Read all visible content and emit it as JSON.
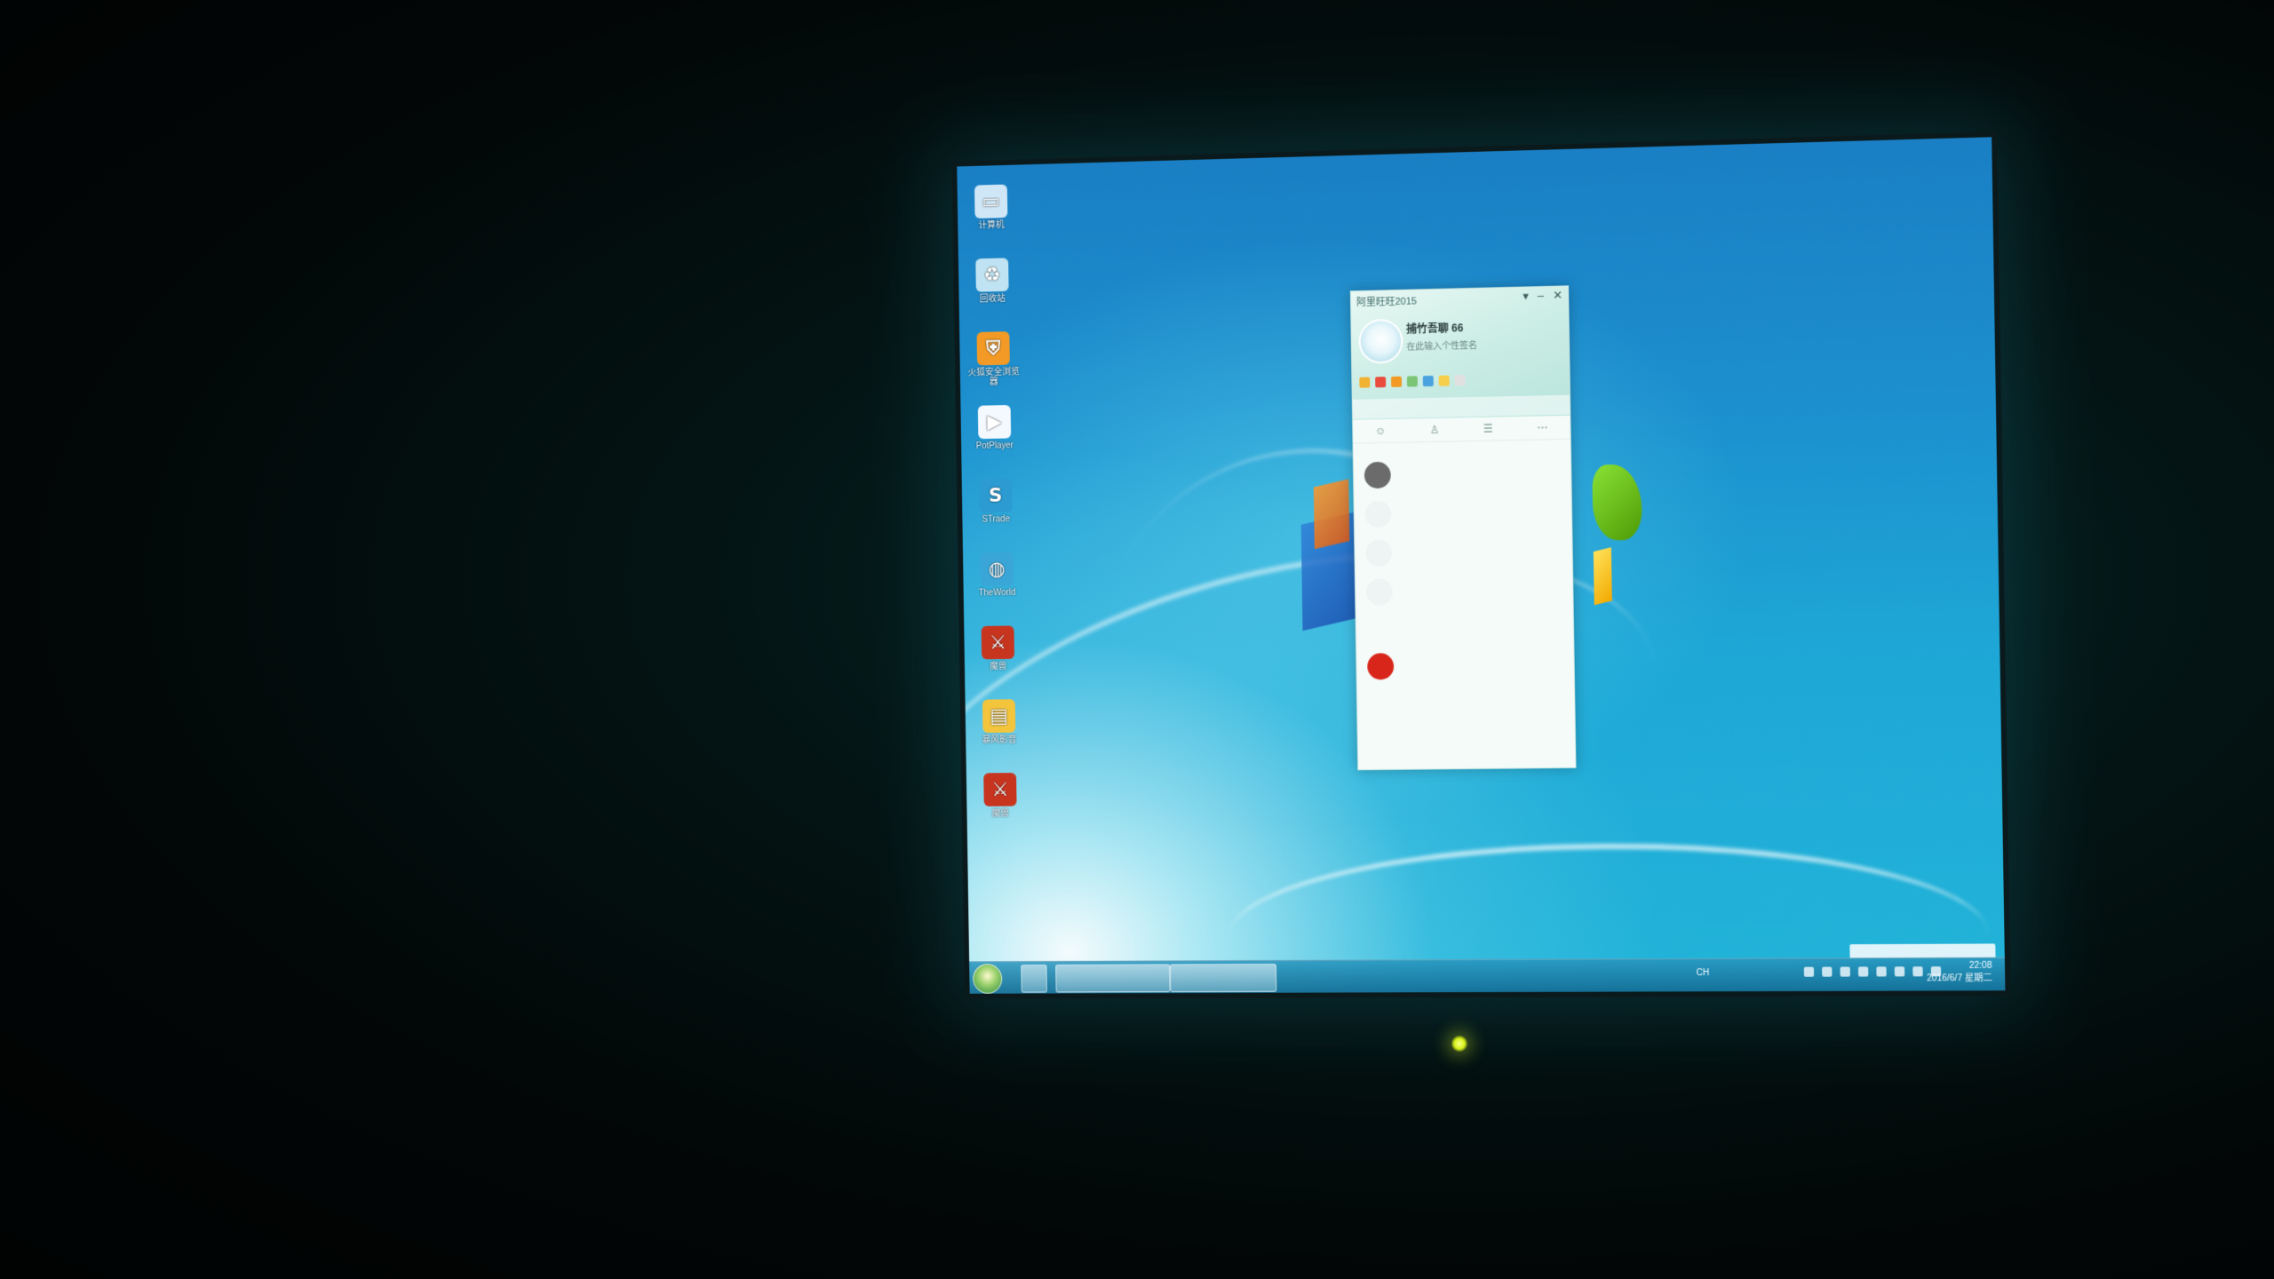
{
  "desktop": {
    "icons": [
      {
        "label": "计算机",
        "icon": "computer-icon",
        "color": "#cfe6f6",
        "glyph": "▭"
      },
      {
        "label": "回收站",
        "icon": "recycle-bin-icon",
        "color": "#bfe3f2",
        "glyph": "♻"
      },
      {
        "label": "火狐安全浏览器",
        "icon": "shield-browser-icon",
        "color": "#f29a25",
        "glyph": "⛨"
      },
      {
        "label": "PotPlayer",
        "icon": "potplayer-icon",
        "color": "#f4f9ff",
        "glyph": "▶"
      },
      {
        "label": "STrade",
        "icon": "strade-icon",
        "color": "#2b9bd1",
        "glyph": "S"
      },
      {
        "label": "TheWorld",
        "icon": "theworld-globe-icon",
        "color": "#3aa6d8",
        "glyph": "◍"
      },
      {
        "label": "魔兽",
        "icon": "game-hero-icon-1",
        "color": "#c8351f",
        "glyph": "⚔"
      },
      {
        "label": "暴风影音",
        "icon": "folder-icon",
        "color": "#f2c53d",
        "glyph": "▤"
      },
      {
        "label": "魔兽",
        "icon": "game-hero-icon-2",
        "color": "#c8351f",
        "glyph": "⚔"
      }
    ]
  },
  "qq": {
    "title": "阿里旺旺2015",
    "nickname": "捕竹吾聊 66",
    "signature": "在此输入个性签名",
    "search_placeholder": "",
    "tabs": [
      "☺",
      "♙",
      "☰",
      "⋯"
    ],
    "app_colors": [
      "#f2b233",
      "#e94b3c",
      "#f29a25",
      "#7cc576",
      "#4aa3df",
      "#f6d04d",
      "#e0e0e0"
    ],
    "contacts": [
      {
        "avatar_color": "#6b6b6b"
      },
      {
        "avatar_color": "#eef4f3"
      },
      {
        "avatar_color": "#eef4f3"
      },
      {
        "avatar_color": "#eef4f3"
      },
      {
        "avatar_color": "#d8261b"
      }
    ]
  },
  "taskbar": {
    "language": "CH",
    "time": "22:08",
    "date": "2016/6/7 星期二"
  }
}
